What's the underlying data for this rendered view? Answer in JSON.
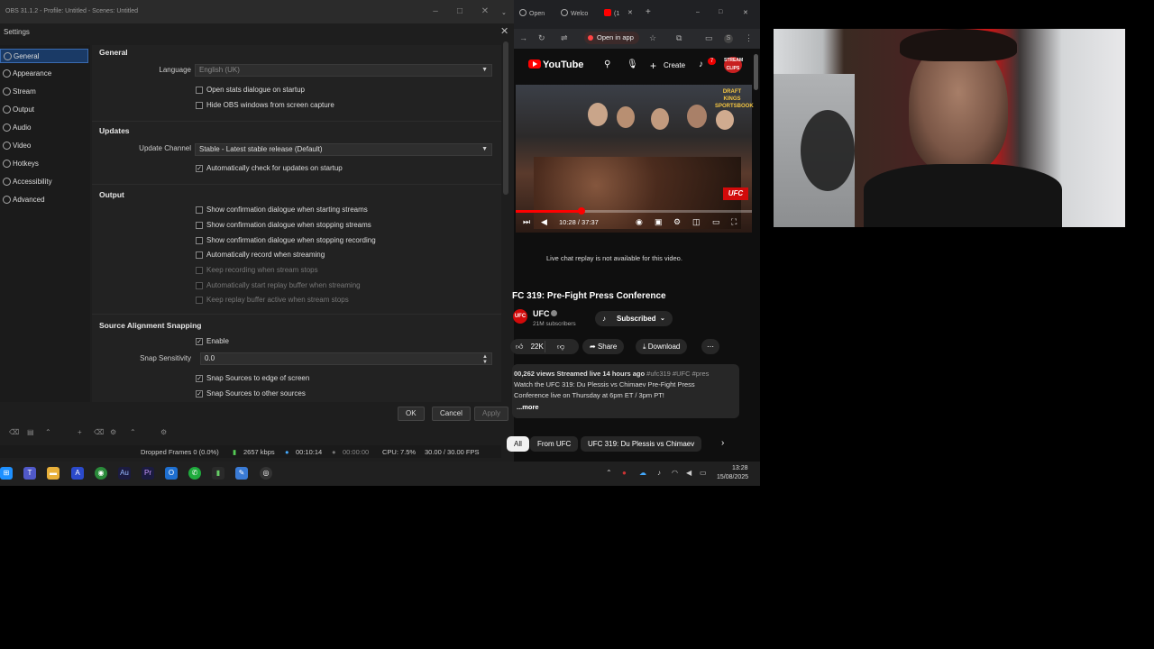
{
  "obs": {
    "window_title": "OBS 31.1.2 - Profile: Untitled - Scenes: Untitled",
    "dialog_title": "Settings",
    "sidebar": [
      {
        "label": "General",
        "icon": "gear-icon",
        "selected": true
      },
      {
        "label": "Appearance",
        "icon": "palette-icon"
      },
      {
        "label": "Stream",
        "icon": "globe-icon"
      },
      {
        "label": "Output",
        "icon": "output-icon"
      },
      {
        "label": "Audio",
        "icon": "speaker-icon"
      },
      {
        "label": "Video",
        "icon": "monitor-icon"
      },
      {
        "label": "Hotkeys",
        "icon": "keyboard-icon"
      },
      {
        "label": "Accessibility",
        "icon": "accessibility-icon"
      },
      {
        "label": "Advanced",
        "icon": "wrench-icon"
      }
    ],
    "general": {
      "title": "General",
      "language_label": "Language",
      "language_value": "English (UK)",
      "open_stats": "Open stats dialogue on startup",
      "hide_obs": "Hide OBS windows from screen capture"
    },
    "updates": {
      "title": "Updates",
      "channel_label": "Update Channel",
      "channel_value": "Stable - Latest stable release (Default)",
      "auto_check": "Automatically check for updates on startup"
    },
    "output": {
      "title": "Output",
      "items": [
        {
          "label": "Show confirmation dialogue when starting streams",
          "checked": false,
          "disabled": false
        },
        {
          "label": "Show confirmation dialogue when stopping streams",
          "checked": false,
          "disabled": false
        },
        {
          "label": "Show confirmation dialogue when stopping recording",
          "checked": false,
          "disabled": false
        },
        {
          "label": "Automatically record when streaming",
          "checked": false,
          "disabled": false
        },
        {
          "label": "Keep recording when stream stops",
          "checked": false,
          "disabled": true
        },
        {
          "label": "Automatically start replay buffer when streaming",
          "checked": false,
          "disabled": true
        },
        {
          "label": "Keep replay buffer active when stream stops",
          "checked": false,
          "disabled": true
        }
      ]
    },
    "snapping": {
      "title": "Source Alignment Snapping",
      "enable": "Enable",
      "sensitivity_label": "Snap Sensitivity",
      "sensitivity_value": "0.0",
      "edge": "Snap Sources to edge of screen",
      "other": "Snap Sources to other sources"
    },
    "buttons": {
      "ok": "OK",
      "cancel": "Cancel",
      "apply": "Apply"
    },
    "status": {
      "dropped": "Dropped Frames 0 (0.0%)",
      "bitrate": "2657 kbps",
      "stream_time": "00:10:14",
      "rec_time": "00:00:00",
      "cpu": "CPU: 7.5%",
      "fps": "30.00 / 30.00 FPS"
    }
  },
  "browser": {
    "tabs": [
      "Open",
      "Welco",
      "(1"
    ],
    "open_in_app": "Open in app",
    "yt_logo": "YouTube",
    "create_label": "Create",
    "bell_count": "7",
    "video_time": "10:28 / 37:37",
    "progress": 0.278,
    "ufc_badge": "UFC",
    "dk_badge": "DRAFT KINGS SPORTSBOOK",
    "live_chat": "Live chat replay is not available for this video.",
    "video_title": "FC 319: Pre-Fight Press Conference",
    "channel_name": "UFC",
    "channel_avatar": "UFC",
    "channel_subs": "21M subscribers",
    "subscribed": "Subscribed",
    "likes": "22K",
    "share": "Share",
    "download": "Download",
    "desc_stats": "00,262 views  Streamed live 14 hours ago",
    "desc_tags": " #ufc319 #UFC #pres",
    "desc_line2": "Watch the UFC 319: Du Plessis vs Chimaev Pre-Fight Press",
    "desc_line3": "Conference live on Thursday at 6pm ET / 3pm PT!",
    "desc_more": "...more",
    "chips": [
      "All",
      "From UFC",
      "UFC 319: Du Plessis vs Chimaev"
    ]
  },
  "taskbar": {
    "time": "13:28",
    "date": "15/08/2025"
  },
  "colors": {
    "accent": "#1a3a66",
    "yt_red": "#ff0000",
    "ufc_red": "#d20a0a"
  }
}
